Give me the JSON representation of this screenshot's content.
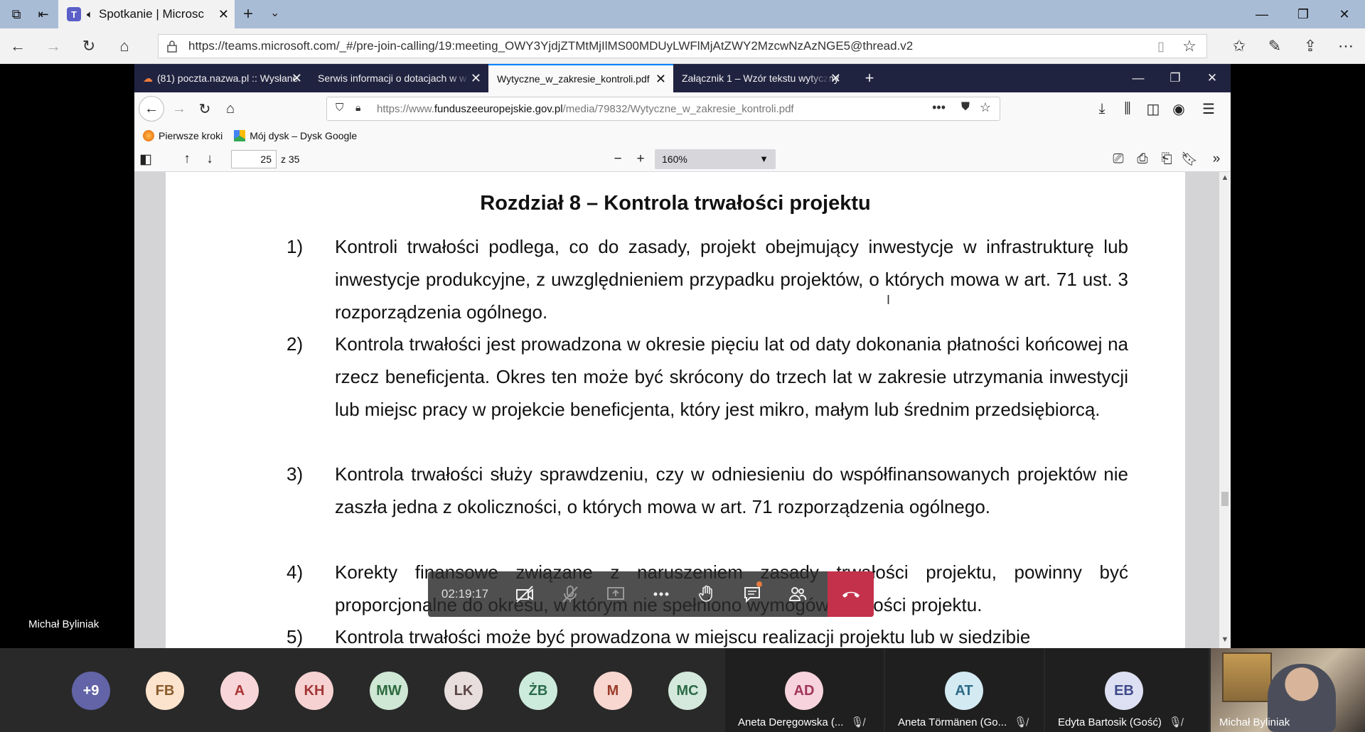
{
  "edge": {
    "tab_title": "Spotkanie | Microsc",
    "url": "https://teams.microsoft.com/_#/pre-join-calling/19:meeting_OWY3YjdjZTMtMjIlMS00MDUyLWFlMjAtZWY2MzcwNzAzNGE5@thread.v2"
  },
  "firefox": {
    "tabs": [
      {
        "label": "(81) poczta.nazwa.pl :: Wysłane"
      },
      {
        "label": "Serwis informacji o dotacjach w w"
      },
      {
        "label": "Wytyczne_w_zakresie_kontroli.pdf"
      },
      {
        "label": "Załącznik 1 – Wzór tekstu wytyczny"
      }
    ],
    "url_prefix": "https://www.",
    "url_domain": "funduszeeuropejskie.gov.pl",
    "url_path": "/media/79832/Wytyczne_w_zakresie_kontroli.pdf",
    "bookmarks": [
      "Pierwsze kroki",
      "Mój dysk – Dysk Google"
    ]
  },
  "pdf": {
    "page_number": "25",
    "page_of": "z 35",
    "zoom": "160%",
    "title": "Rozdział 8 – Kontrola trwałości projektu",
    "items": [
      {
        "num": "1)",
        "text": "Kontroli trwałości podlega, co do zasady, projekt obejmujący inwestycje w infrastrukturę lub inwestycje produkcyjne, z uwzględnieniem przypadku projektów, o których mowa w art. 71 ust. 3 rozporządzenia ogólnego."
      },
      {
        "num": "2)",
        "text": "Kontrola trwałości jest prowadzona w okresie pięciu lat od daty dokonania płatności końcowej na rzecz beneficjenta. Okres ten może być skrócony do trzech lat w zakresie utrzymania inwestycji lub miejsc pracy w projekcie beneficjenta, który jest mikro, małym lub średnim przedsiębiorcą."
      },
      {
        "num": "3)",
        "text": "Kontrola trwałości służy sprawdzeniu, czy w odniesieniu do współfinansowanych projektów nie zaszła jedna z okoliczności, o których mowa w art. 71 rozporządzenia ogólnego."
      },
      {
        "num": "4)",
        "text": "Korekty finansowe związane z naruszeniem zasady trwałości projektu, powinny być proporcjonalne do okresu, w którym nie spełniono wymogów trwałości projektu."
      },
      {
        "num": "5)",
        "text": "Kontrola trwałości może być prowadzona w miejscu realizacji projektu lub w siedzibie"
      }
    ]
  },
  "meeting": {
    "timer": "02:19:17",
    "presenter_name": "Michał Byliniak",
    "participants_small": [
      {
        "initials": "+9",
        "bg": "#6264a7",
        "fg": "#ffffff"
      },
      {
        "initials": "FB",
        "bg": "#fbe3cd",
        "fg": "#8a5a2b"
      },
      {
        "initials": "A",
        "bg": "#f8d5d8",
        "fg": "#a33"
      },
      {
        "initials": "KH",
        "bg": "#f6d2d2",
        "fg": "#a23535"
      },
      {
        "initials": "MW",
        "bg": "#cfe7d5",
        "fg": "#2d6a3e"
      },
      {
        "initials": "LK",
        "bg": "#e8dede",
        "fg": "#5a4545"
      },
      {
        "initials": "ŻB",
        "bg": "#cdebdc",
        "fg": "#2b6b4c"
      },
      {
        "initials": "M",
        "bg": "#f7d7d0",
        "fg": "#9b3b2a"
      },
      {
        "initials": "MC",
        "bg": "#d4e9dc",
        "fg": "#2c6a46"
      }
    ],
    "participants_named": [
      {
        "initials": "AD",
        "name": "Aneta Deręgowska (...",
        "bg": "#f6d3dd",
        "fg": "#a2345a"
      },
      {
        "initials": "AT",
        "name": "Aneta Törmänen (Go...",
        "bg": "#d3eaf3",
        "fg": "#2b6a86"
      },
      {
        "initials": "EB",
        "name": "Edyta Bartosik (Gość)",
        "bg": "#dde0f2",
        "fg": "#3e4a8a"
      }
    ],
    "video_name": "Michał Byliniak"
  }
}
